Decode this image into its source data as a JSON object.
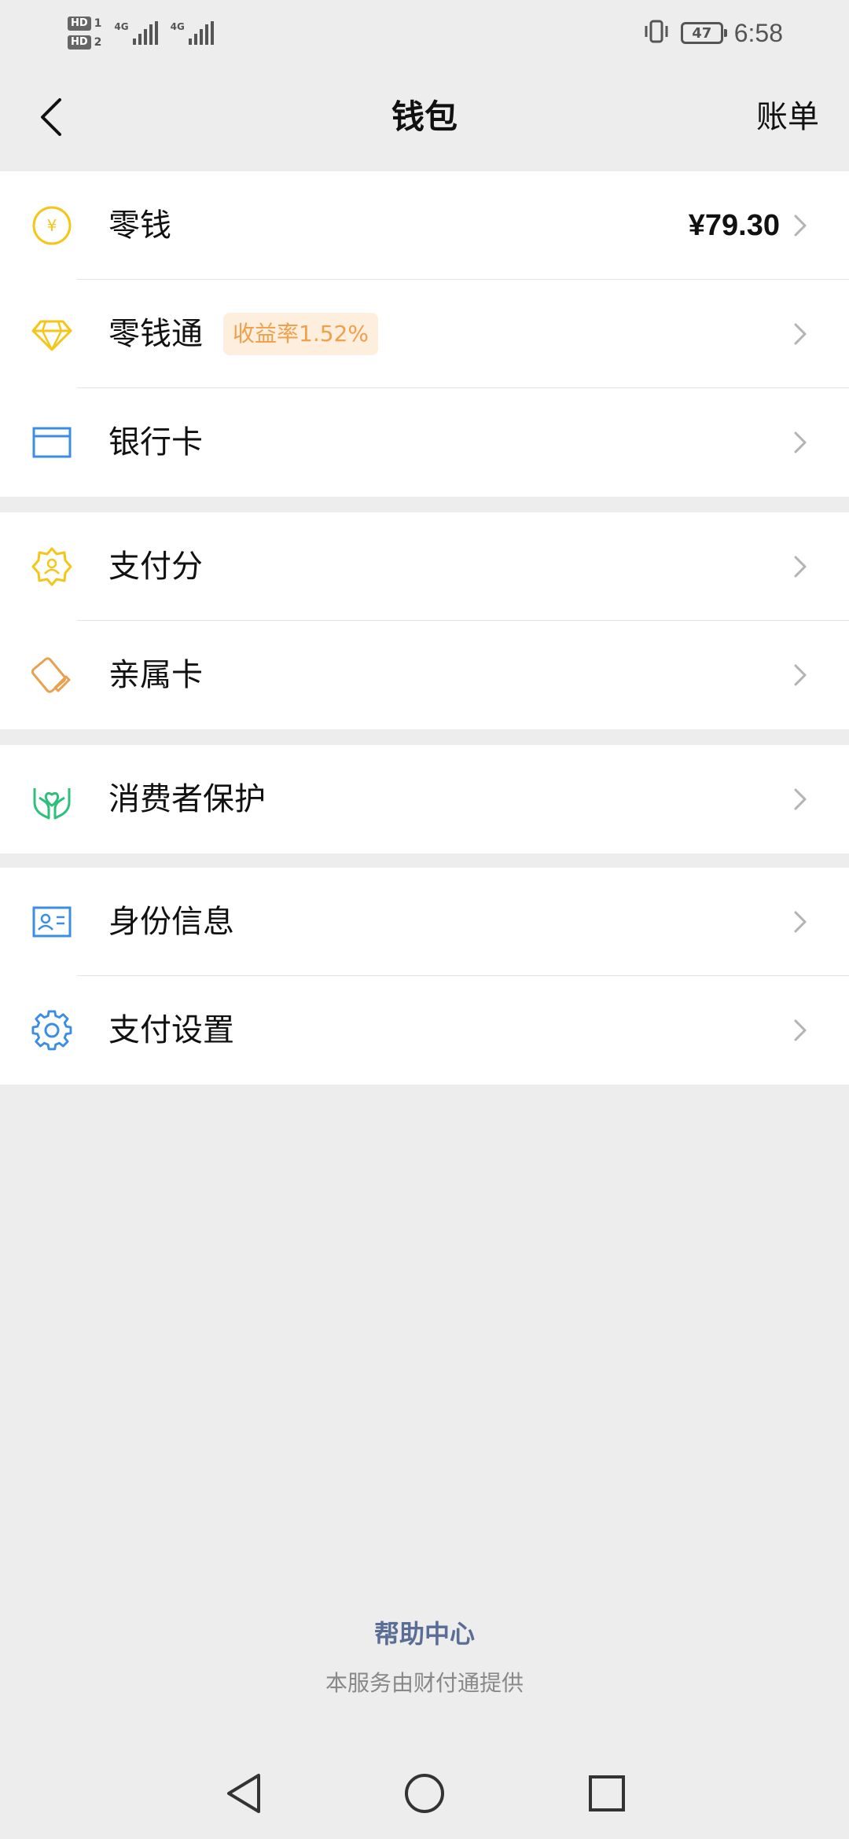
{
  "status_bar": {
    "sim1_label": "HD",
    "sim1_num": "1",
    "sim2_label": "HD",
    "sim2_num": "2",
    "net1": "4G",
    "net2": "4G",
    "battery": "47",
    "time": "6:58"
  },
  "header": {
    "title": "钱包",
    "bill_label": "账单"
  },
  "sections": [
    {
      "items": [
        {
          "label": "零钱",
          "value": "¥79.30",
          "icon": "yuan-coin-icon"
        },
        {
          "label": "零钱通",
          "badge": "收益率1.52%",
          "icon": "diamond-icon"
        },
        {
          "label": "银行卡",
          "icon": "bank-card-icon"
        }
      ]
    },
    {
      "items": [
        {
          "label": "支付分",
          "icon": "payscore-icon"
        },
        {
          "label": "亲属卡",
          "icon": "family-card-icon"
        }
      ]
    },
    {
      "items": [
        {
          "label": "消费者保护",
          "icon": "consumer-protection-icon"
        }
      ]
    },
    {
      "items": [
        {
          "label": "身份信息",
          "icon": "id-card-icon"
        },
        {
          "label": "支付设置",
          "icon": "settings-gear-icon"
        }
      ]
    }
  ],
  "footer": {
    "help_center": "帮助中心",
    "provider": "本服务由财付通提供"
  },
  "colors": {
    "yellow": "#f5c518",
    "blue": "#3a8ee6",
    "green": "#2ebf7a",
    "orange": "#e9a050",
    "badge_bg": "#fdeedd",
    "badge_text": "#f0a04b",
    "help_link": "#5a6d94"
  }
}
